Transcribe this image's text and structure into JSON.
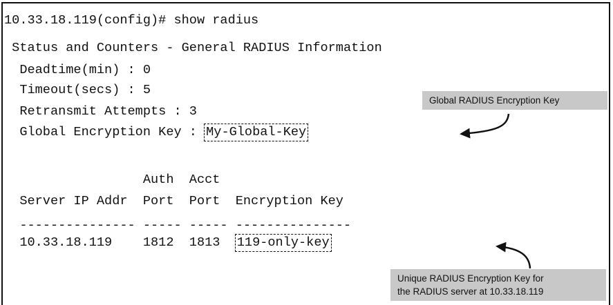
{
  "terminal": {
    "command_line": "10.33.18.119(config)# show radius",
    "heading": " Status and Counters - General RADIUS Information",
    "deadtime_line": "  Deadtime(min) : 0",
    "timeout_line": "  Timeout(secs) : 5",
    "retransmit_line": "  Retransmit Attempts : 3",
    "global_key_label": "  Global Encryption Key : ",
    "global_key_value": "My-Global-Key",
    "table": {
      "header_row1": "                  Auth  Acct",
      "header_row2": "  Server IP Addr  Port  Port  Encryption Key",
      "separator": "  --------------- ----- ----- ---------------",
      "row_prefix": "  10.33.18.119    1812  1813  ",
      "row_key": "119-only-key"
    }
  },
  "callouts": {
    "global": "Global RADIUS Encryption Key",
    "unique_line1": "Unique RADIUS Encryption Key for",
    "unique_line2": "the RADIUS server at 10.33.18.119"
  }
}
